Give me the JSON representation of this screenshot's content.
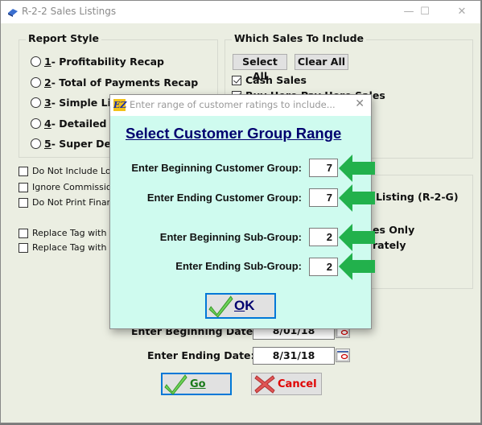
{
  "window": {
    "title": "R-2-2  Sales Listings",
    "controls": {
      "minimize": "—",
      "maximize": "☐",
      "close": "✕"
    }
  },
  "report_style": {
    "title": "Report Style",
    "options": [
      {
        "key": "1",
        "label": " - Profitability Recap",
        "selected": false
      },
      {
        "key": "2",
        "label": " - Total of Payments Recap",
        "selected": false
      },
      {
        "key": "3",
        "label": " - Simple Lis",
        "selected": false
      },
      {
        "key": "4",
        "label": " - Detailed L",
        "selected": false
      },
      {
        "key": "5",
        "label": " - Super Det",
        "selected": false
      }
    ]
  },
  "options_checks": [
    {
      "label": "Do Not Include Lot",
      "checked": false
    },
    {
      "label": "Ignore Commission",
      "checked": false
    },
    {
      "label": "Do Not Print Finan",
      "checked": false
    },
    {
      "label": "Replace Tag with Te",
      "checked": false
    },
    {
      "label": "Replace Tag with G",
      "checked": false
    }
  ],
  "which_sales": {
    "title": "Which Sales To Include",
    "select_all": "Select All",
    "clear_all": "Clear All",
    "items": [
      {
        "label": "Cash Sales",
        "checked": true
      },
      {
        "label": "Buy Here Pay Here Sales",
        "checked": true
      }
    ]
  },
  "right_group": {
    "listing_label": "Listing (R-2-G)",
    "line1": "es Only",
    "line2": "rately"
  },
  "dates": {
    "beginning_label": "Enter Beginning Date:",
    "beginning_value": "8/01/18",
    "ending_label": "Enter Ending Date:",
    "ending_value": "8/31/18"
  },
  "buttons": {
    "go": "Go",
    "cancel": "Cancel"
  },
  "dialog": {
    "title": "Enter range of customer ratings to include...",
    "icon_text": "EZ",
    "close": "✕",
    "heading": "Select Customer Group Range",
    "fields": [
      {
        "label": "Enter Beginning Customer Group:",
        "value": "7"
      },
      {
        "label": "Enter Ending Customer Group:",
        "value": "7"
      },
      {
        "label": "Enter Beginning Sub-Group:",
        "value": "2"
      },
      {
        "label": "Enter Ending Sub-Group:",
        "value": "2"
      }
    ],
    "ok": "OK"
  },
  "colors": {
    "dialog_bg": "#cffbef",
    "heading": "#00006f",
    "arrow": "#22b14c",
    "window_bg": "#ebeee2",
    "focus": "#0078d7",
    "cancel_text": "#e00000",
    "go_text": "#1a7a1a"
  }
}
